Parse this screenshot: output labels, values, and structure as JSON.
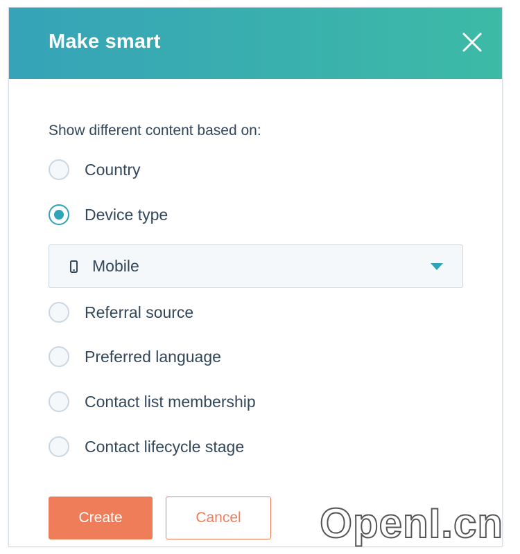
{
  "dialog": {
    "title": "Make smart",
    "header_gradient": [
      "#36a3b8",
      "#3dbaa6"
    ],
    "close_icon": "close-icon"
  },
  "form": {
    "prompt": "Show different content based on:",
    "options": [
      {
        "label": "Country",
        "checked": false
      },
      {
        "label": "Device type",
        "checked": true
      },
      {
        "label": "Referral source",
        "checked": false
      },
      {
        "label": "Preferred language",
        "checked": false
      },
      {
        "label": "Contact list membership",
        "checked": false
      },
      {
        "label": "Contact lifecycle stage",
        "checked": false
      }
    ],
    "device_select": {
      "value": "Mobile",
      "icon": "mobile-phone-icon"
    }
  },
  "actions": {
    "create_label": "Create",
    "cancel_label": "Cancel",
    "accent_color": "#f07d5a"
  },
  "watermark": "OpenI.cn"
}
